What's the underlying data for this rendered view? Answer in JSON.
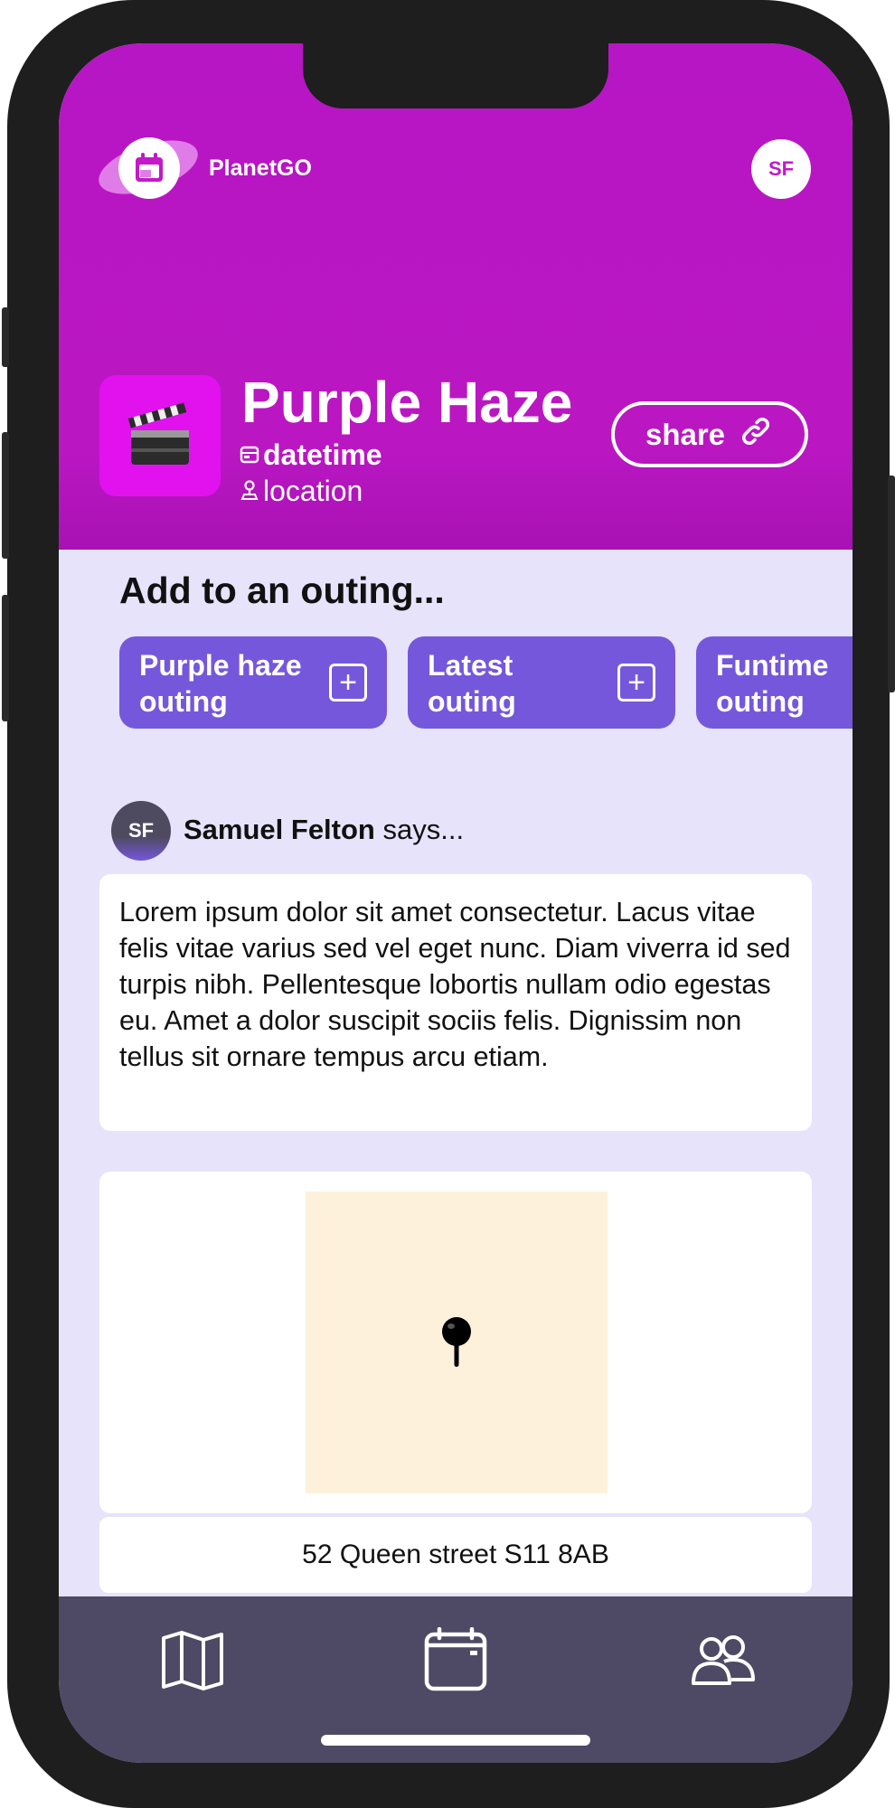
{
  "app": {
    "brand": "PlanetGO",
    "user_initials": "SF"
  },
  "event": {
    "title": "Purple Haze",
    "datetime": "datetime",
    "location": "location",
    "share_label": "share"
  },
  "outings": {
    "heading": "Add to an outing...",
    "items": [
      {
        "label": "Purple haze outing"
      },
      {
        "label": "Latest outing"
      },
      {
        "label": "Funtime outing"
      }
    ]
  },
  "comment": {
    "initials": "SF",
    "author": "Samuel Felton",
    "says": " says...",
    "text": "Lorem ipsum dolor sit amet consectetur. Lacus vitae felis vitae varius sed vel eget nunc. Diam viverra id sed turpis nibh. Pellentesque lobortis nullam odio egestas eu. Amet a dolor suscipit sociis felis. Dignissim non tellus sit ornare tempus arcu etiam."
  },
  "location_card": {
    "address": "52 Queen street S11 8AB"
  },
  "nav": {
    "items": [
      "map-icon",
      "calendar-icon",
      "people-icon"
    ]
  },
  "colors": {
    "header": "#b716c4",
    "chip": "#7557dc",
    "background": "#e7e3fb",
    "bottom_bar": "#4e4964"
  }
}
